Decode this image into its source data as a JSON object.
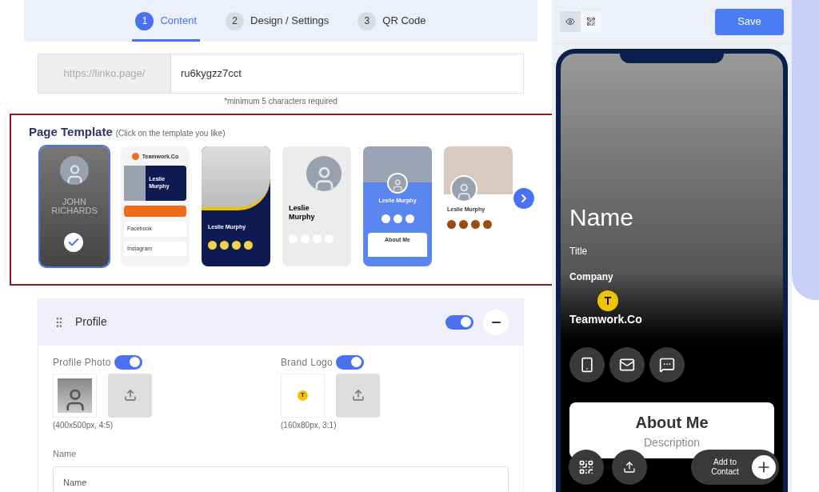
{
  "steps": [
    {
      "number": "1",
      "label": "Content",
      "selected": true
    },
    {
      "number": "2",
      "label": "Design / Settings",
      "selected": false
    },
    {
      "number": "3",
      "label": "QR Code",
      "selected": false
    }
  ],
  "page_code": {
    "prefix": "https://linko.page/",
    "value": "ru6kygzz7cct",
    "hint": "*minimum 5 characters required"
  },
  "page_template": {
    "title": "Page Template",
    "subtitle": "(Click on the template you like)",
    "templates": [
      {
        "kind": "dark",
        "selected": true,
        "texts": [
          "JOHN",
          "RICHARDS"
        ]
      },
      {
        "kind": "business",
        "selected": false,
        "texts": [
          "Teamwork.Co",
          "Leslie Murphy",
          "Facebook",
          "Instagram"
        ]
      },
      {
        "kind": "wave",
        "selected": false,
        "texts": [
          "Leslie Murphy"
        ]
      },
      {
        "kind": "minimal",
        "selected": false,
        "texts": [
          "Leslie Murphy"
        ]
      },
      {
        "kind": "blue",
        "selected": false,
        "texts": [
          "Leslie Murphy",
          "About Me"
        ]
      },
      {
        "kind": "warm",
        "selected": false,
        "texts": [
          "Leslie Murphy"
        ]
      }
    ]
  },
  "profile_section": {
    "title": "Profile",
    "enabled": true,
    "expanded": true,
    "profile_photo": {
      "label": "Profile Photo",
      "on": true,
      "hint": "(400x500px, 4:5)"
    },
    "brand_logo": {
      "label": "Brand Logo",
      "on": true,
      "logo_letter": "T",
      "hint": "(160x80px, 3:1)"
    },
    "name_field": {
      "label": "Name",
      "placeholder": "Name"
    }
  },
  "preview": {
    "view_modes": [
      {
        "kind": "eye",
        "selected": true
      },
      {
        "kind": "qr",
        "selected": false
      }
    ],
    "save": "Save",
    "card": {
      "name": "Name",
      "title": "Title",
      "company": "Company",
      "logo_letter": "T",
      "brand": "Teamwork.Co",
      "actions": [
        {
          "kind": "phone"
        },
        {
          "kind": "mail"
        },
        {
          "kind": "message"
        }
      ],
      "about_title": "About Me",
      "about_text": "Description",
      "add_contact": "Add to Contact"
    }
  }
}
